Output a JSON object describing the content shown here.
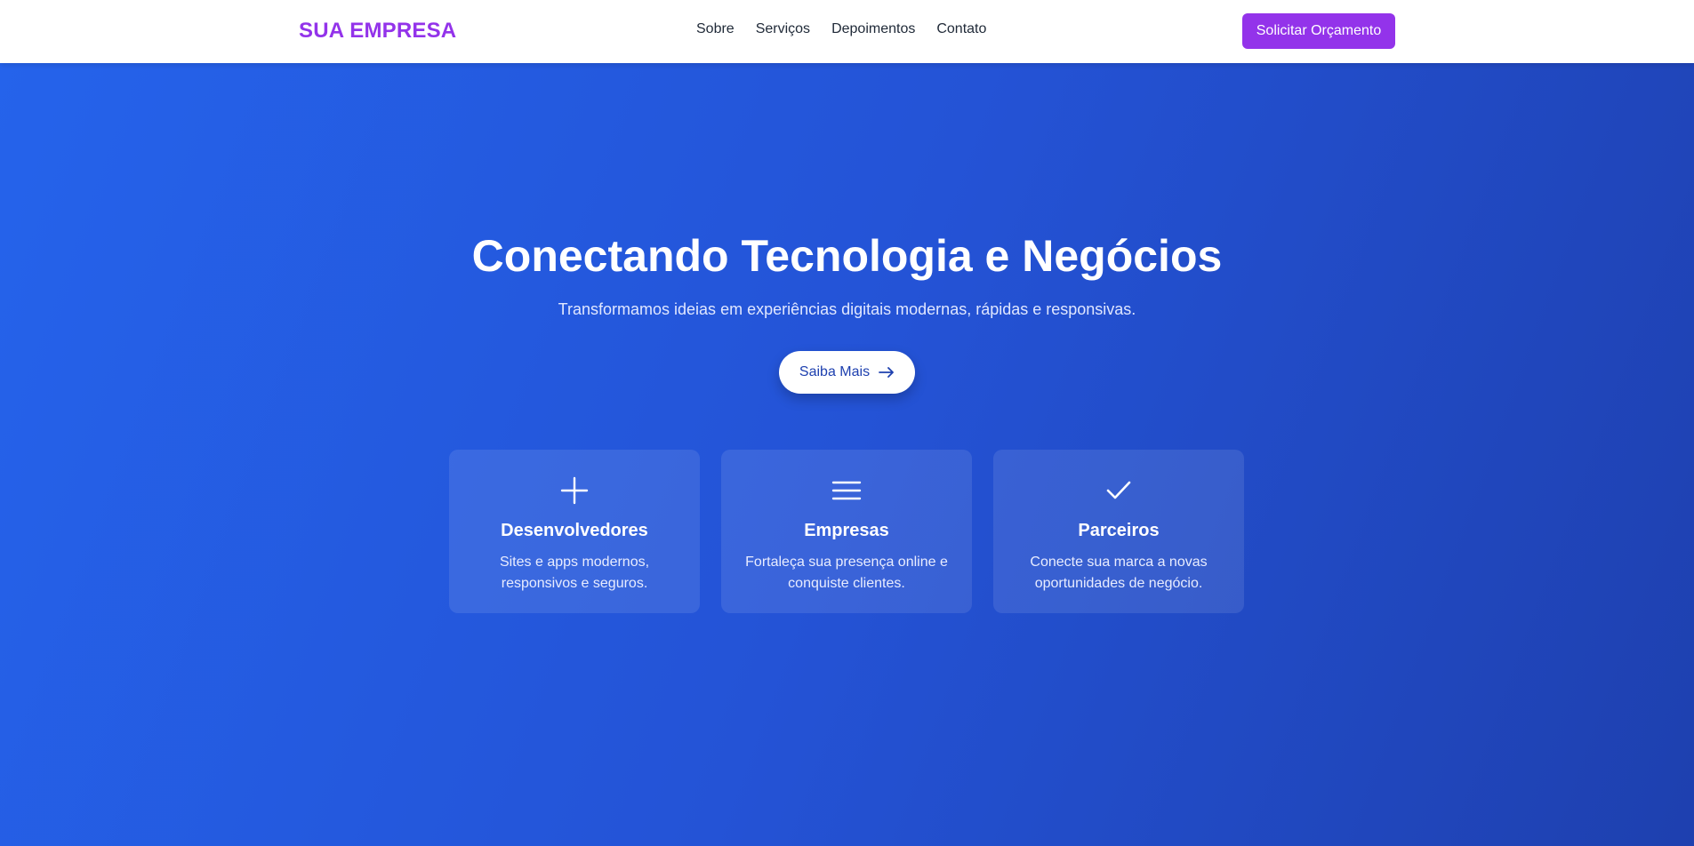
{
  "header": {
    "logo": "SUA EMPRESA",
    "nav": [
      "Sobre",
      "Serviços",
      "Depoimentos",
      "Contato"
    ],
    "cta_label": "Solicitar Orçamento"
  },
  "hero": {
    "title": "Conectando Tecnologia e Negócios",
    "subtitle": "Transformamos ideias em experiências digitais modernas, rápidas e responsivas.",
    "button_label": "Saiba Mais"
  },
  "cards": [
    {
      "icon": "plus-icon",
      "title": "Desenvolvedores",
      "description": "Sites e apps modernos, responsivos e seguros."
    },
    {
      "icon": "menu-icon",
      "title": "Empresas",
      "description": "Fortaleça sua presença online e conquiste clientes."
    },
    {
      "icon": "check-icon",
      "title": "Parceiros",
      "description": "Conecte sua marca a novas oportunidades de negócio."
    }
  ],
  "colors": {
    "brand": "#9333ea",
    "hero_gradient_start": "#2563eb",
    "hero_gradient_end": "#1e40af",
    "nav_text": "#1f2937"
  }
}
